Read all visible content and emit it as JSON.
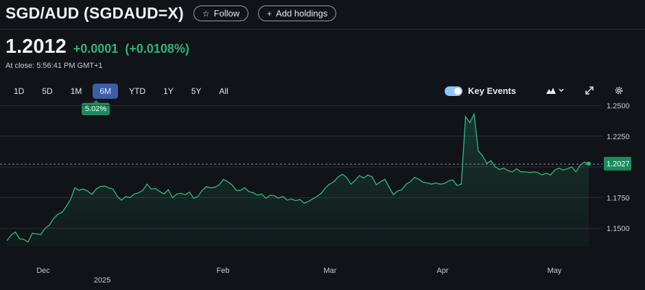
{
  "header": {
    "title": "SGD/AUD (SGDAUD=X)",
    "follow_label": "Follow",
    "add_holdings_label": "Add holdings"
  },
  "quote": {
    "price": "1.2012",
    "change": "+0.0001",
    "change_pct": "(+0.0108%)",
    "close_time": "At close: 5:56:41 PM GMT+1"
  },
  "ranges": [
    "1D",
    "5D",
    "1M",
    "6M",
    "YTD",
    "1Y",
    "5Y",
    "All"
  ],
  "active_range": "6M",
  "range_change_badge": "5.02%",
  "key_events": {
    "label": "Key Events",
    "enabled": true
  },
  "icons": {
    "chart_type": "mountain-icon",
    "expand": "expand-icon",
    "settings": "gear-icon"
  },
  "colors": {
    "background": "#101318",
    "line": "#2fb37c",
    "badge": "#1d8a5b",
    "active_range": "#3b5ea8"
  },
  "chart_data": {
    "type": "area",
    "x_labels": [
      "Dec",
      "Feb",
      "Mar",
      "Apr",
      "May"
    ],
    "year_label": "2025",
    "y_ticks": [
      1.25,
      1.225,
      1.2,
      1.175,
      1.15
    ],
    "y_tick_labels": [
      "1.2500",
      "1.2250",
      "1.2000",
      "1.1750",
      "1.1500"
    ],
    "ylim": [
      1.135,
      1.255
    ],
    "current_value": 1.2027,
    "current_label": "1.2027",
    "reference_value": 1.2023,
    "grid": true,
    "points": [
      [
        0,
        1.14
      ],
      [
        1,
        1.1445
      ],
      [
        2,
        1.147
      ],
      [
        3,
        1.1415
      ],
      [
        4,
        1.141
      ],
      [
        5,
        1.139
      ],
      [
        6,
        1.146
      ],
      [
        7,
        1.1455
      ],
      [
        8,
        1.145
      ],
      [
        9,
        1.15
      ],
      [
        10,
        1.1525
      ],
      [
        11,
        1.158
      ],
      [
        12,
        1.1615
      ],
      [
        13,
        1.163
      ],
      [
        14,
        1.168
      ],
      [
        15,
        1.1735
      ],
      [
        16,
        1.183
      ],
      [
        17,
        1.181
      ],
      [
        18,
        1.182
      ],
      [
        19,
        1.1805
      ],
      [
        20,
        1.1775
      ],
      [
        21,
        1.182
      ],
      [
        22,
        1.184
      ],
      [
        23,
        1.1845
      ],
      [
        24,
        1.183
      ],
      [
        25,
        1.182
      ],
      [
        26,
        1.176
      ],
      [
        27,
        1.173
      ],
      [
        28,
        1.176
      ],
      [
        29,
        1.175
      ],
      [
        30,
        1.178
      ],
      [
        31,
        1.179
      ],
      [
        32,
        1.181
      ],
      [
        33,
        1.186
      ],
      [
        34,
        1.182
      ],
      [
        35,
        1.1825
      ],
      [
        36,
        1.18
      ],
      [
        37,
        1.178
      ],
      [
        38,
        1.1815
      ],
      [
        39,
        1.175
      ],
      [
        40,
        1.178
      ],
      [
        41,
        1.1785
      ],
      [
        42,
        1.1775
      ],
      [
        43,
        1.1795
      ],
      [
        44,
        1.1745
      ],
      [
        45,
        1.176
      ],
      [
        46,
        1.181
      ],
      [
        47,
        1.184
      ],
      [
        48,
        1.183
      ],
      [
        49,
        1.1835
      ],
      [
        50,
        1.1855
      ],
      [
        51,
        1.19
      ],
      [
        52,
        1.188
      ],
      [
        53,
        1.1855
      ],
      [
        54,
        1.181
      ],
      [
        55,
        1.181
      ],
      [
        56,
        1.183
      ],
      [
        57,
        1.18
      ],
      [
        58,
        1.179
      ],
      [
        59,
        1.177
      ],
      [
        60,
        1.178
      ],
      [
        61,
        1.1745
      ],
      [
        62,
        1.177
      ],
      [
        63,
        1.1765
      ],
      [
        64,
        1.1745
      ],
      [
        65,
        1.176
      ],
      [
        66,
        1.173
      ],
      [
        67,
        1.174
      ],
      [
        68,
        1.1725
      ],
      [
        69,
        1.1735
      ],
      [
        70,
        1.1705
      ],
      [
        71,
        1.172
      ],
      [
        72,
        1.174
      ],
      [
        73,
        1.176
      ],
      [
        74,
        1.1785
      ],
      [
        75,
        1.183
      ],
      [
        76,
        1.186
      ],
      [
        77,
        1.188
      ],
      [
        78,
        1.192
      ],
      [
        79,
        1.194
      ],
      [
        80,
        1.1915
      ],
      [
        81,
        1.186
      ],
      [
        82,
        1.189
      ],
      [
        83,
        1.193
      ],
      [
        84,
        1.191
      ],
      [
        85,
        1.1935
      ],
      [
        86,
        1.192
      ],
      [
        87,
        1.1855
      ],
      [
        88,
        1.188
      ],
      [
        89,
        1.19
      ],
      [
        90,
        1.1835
      ],
      [
        91,
        1.1775
      ],
      [
        92,
        1.1805
      ],
      [
        93,
        1.1815
      ],
      [
        94,
        1.186
      ],
      [
        95,
        1.188
      ],
      [
        96,
        1.1915
      ],
      [
        97,
        1.19
      ],
      [
        98,
        1.1875
      ],
      [
        99,
        1.187
      ],
      [
        100,
        1.186
      ],
      [
        101,
        1.187
      ],
      [
        102,
        1.186
      ],
      [
        103,
        1.1865
      ],
      [
        104,
        1.1885
      ],
      [
        105,
        1.1895
      ],
      [
        106,
        1.185
      ],
      [
        107,
        1.186
      ],
      [
        108,
        1.241
      ],
      [
        109,
        1.236
      ],
      [
        110,
        1.243
      ],
      [
        111,
        1.213
      ],
      [
        112,
        1.209
      ],
      [
        113,
        1.203
      ],
      [
        114,
        1.205
      ],
      [
        115,
        1.2
      ],
      [
        116,
        1.198
      ],
      [
        117,
        1.199
      ],
      [
        118,
        1.197
      ],
      [
        119,
        1.196
      ],
      [
        120,
        1.1985
      ],
      [
        121,
        1.196
      ],
      [
        122,
        1.196
      ],
      [
        123,
        1.1955
      ],
      [
        124,
        1.196
      ],
      [
        125,
        1.1955
      ],
      [
        126,
        1.1935
      ],
      [
        127,
        1.195
      ],
      [
        128,
        1.1935
      ],
      [
        129,
        1.1975
      ],
      [
        130,
        1.199
      ],
      [
        131,
        1.1975
      ],
      [
        132,
        1.1985
      ],
      [
        133,
        1.2
      ],
      [
        134,
        1.196
      ],
      [
        135,
        1.2015
      ],
      [
        136,
        1.204
      ],
      [
        137,
        1.2027
      ]
    ]
  }
}
